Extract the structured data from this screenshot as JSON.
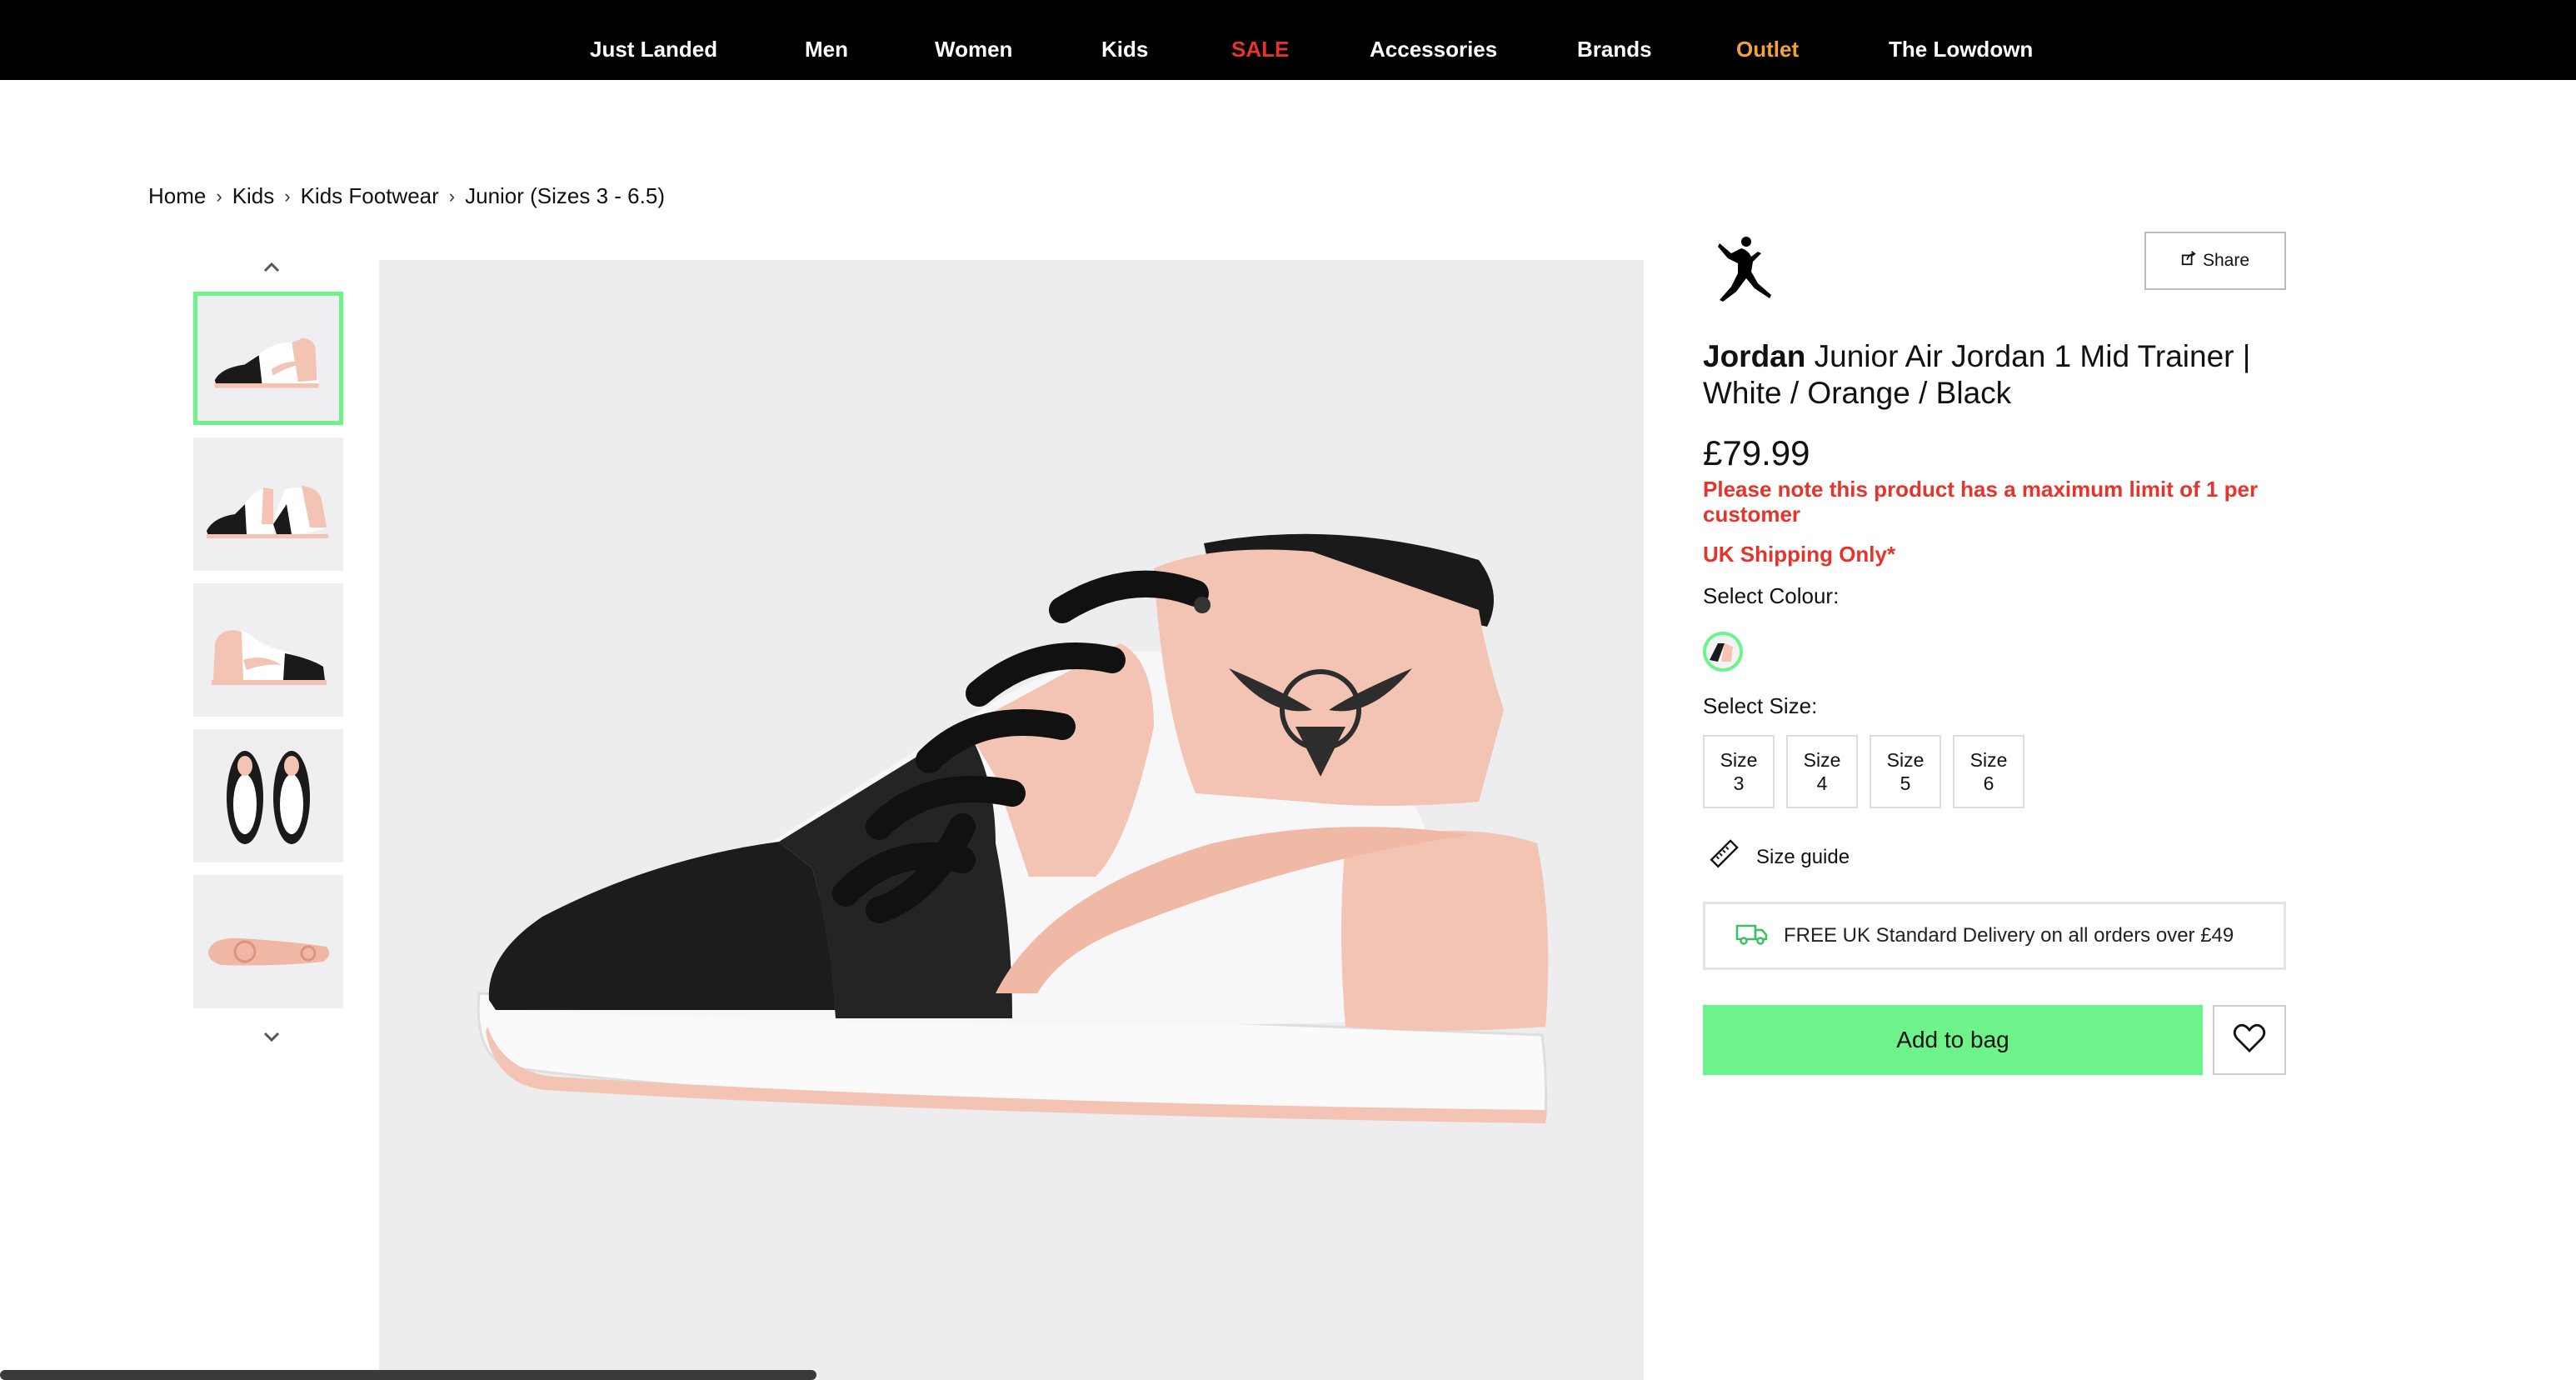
{
  "nav": {
    "items": [
      {
        "label": "Just Landed",
        "color": "#ffffff"
      },
      {
        "label": "Men",
        "color": "#ffffff"
      },
      {
        "label": "Women",
        "color": "#ffffff"
      },
      {
        "label": "Kids",
        "color": "#ffffff"
      },
      {
        "label": "SALE",
        "color": "#e4342b"
      },
      {
        "label": "Accessories",
        "color": "#ffffff"
      },
      {
        "label": "Brands",
        "color": "#ffffff"
      },
      {
        "label": "Outlet",
        "color": "#f2a23b"
      },
      {
        "label": "The Lowdown",
        "color": "#ffffff"
      }
    ]
  },
  "breadcrumb": {
    "items": [
      "Home",
      "Kids",
      "Kids Footwear",
      "Junior (Sizes 3 - 6.5)"
    ],
    "separator": "›"
  },
  "gallery": {
    "up_icon": "chevron-up-icon",
    "down_icon": "chevron-down-icon",
    "thumbnails": [
      {
        "view": "side",
        "active": true
      },
      {
        "view": "pair",
        "active": false
      },
      {
        "view": "inner-side",
        "active": false
      },
      {
        "view": "top",
        "active": false
      },
      {
        "view": "sole",
        "active": false
      }
    ]
  },
  "product": {
    "brand": "Jordan",
    "name": "Junior Air Jordan 1 Mid Trainer | White / Orange / Black",
    "price": "£79.99",
    "limit_note": "Please note this product has a maximum limit of 1 per customer",
    "shipping_note": "UK Shipping Only*",
    "select_colour_label": "Select Colour:",
    "select_size_label": "Select Size:",
    "sizes": [
      {
        "line1": "Size",
        "line2": "3"
      },
      {
        "line1": "Size",
        "line2": "4"
      },
      {
        "line1": "Size",
        "line2": "5"
      },
      {
        "line1": "Size",
        "line2": "6"
      }
    ],
    "size_guide_label": "Size guide",
    "delivery_text": "FREE UK Standard Delivery on all orders over £49",
    "add_to_bag_label": "Add to bag",
    "share_label": "Share"
  },
  "colors": {
    "accent_green": "#6ef28a",
    "sale_red": "#e4342b",
    "outlet_orange": "#f2a23b",
    "shoe_peach": "#f3c4b3"
  },
  "icons": {
    "share": "share-icon",
    "ruler": "ruler-icon",
    "truck": "truck-icon",
    "heart": "heart-icon",
    "brand_logo": "jumpman-logo"
  }
}
